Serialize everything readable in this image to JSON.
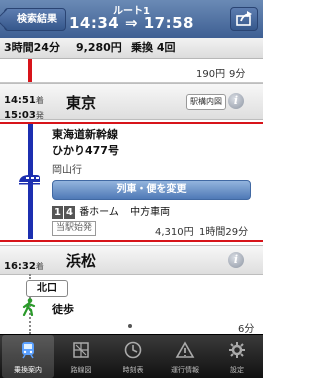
{
  "nav": {
    "back_label": "検索結果",
    "title_small": "ルート1",
    "title_main": "14:34 ⇒ 17:58",
    "share_icon": "share-icon"
  },
  "summary": {
    "duration": "3時間24分",
    "fare": "9,280円",
    "transfers": "乗換 4回"
  },
  "prev_segment": {
    "fare": "190円",
    "time": "9分"
  },
  "tokyo": {
    "arrive_time": "14:51",
    "arrive_suffix": "着",
    "depart_time": "15:03",
    "depart_suffix": "発",
    "name": "東京",
    "map_label": "駅構内図"
  },
  "train": {
    "line": "東海道新幹線",
    "name": "ひかり477号",
    "destination": "岡山行",
    "change_label": "列車・便を変更",
    "platform_digits": [
      "1",
      "4"
    ],
    "platform_suffix": "番ホーム",
    "car_position": "中方車両",
    "origin_tag": "当駅始発",
    "fare": "4,310円",
    "duration": "1時間29分",
    "line_color": "#1c2fb0"
  },
  "hamamatsu": {
    "arrive_time": "16:32",
    "arrive_suffix": "着",
    "name": "浜松"
  },
  "walk": {
    "exit_label": "北口",
    "mode": "徒歩",
    "time": "6分"
  },
  "tabs": [
    {
      "label": "乗換案内",
      "icon": "train-icon",
      "active": true
    },
    {
      "label": "路線図",
      "icon": "route-map-icon",
      "active": false
    },
    {
      "label": "時刻表",
      "icon": "clock-icon",
      "active": false
    },
    {
      "label": "運行情報",
      "icon": "service-info-icon",
      "active": false
    },
    {
      "label": "設定",
      "icon": "settings-icon",
      "active": false
    }
  ],
  "colors": {
    "accent_red": "#d7141a",
    "nav_blue": "#3e5f93",
    "shinkansen_blue": "#1c2fb0",
    "walk_green": "#2a9a2a"
  }
}
